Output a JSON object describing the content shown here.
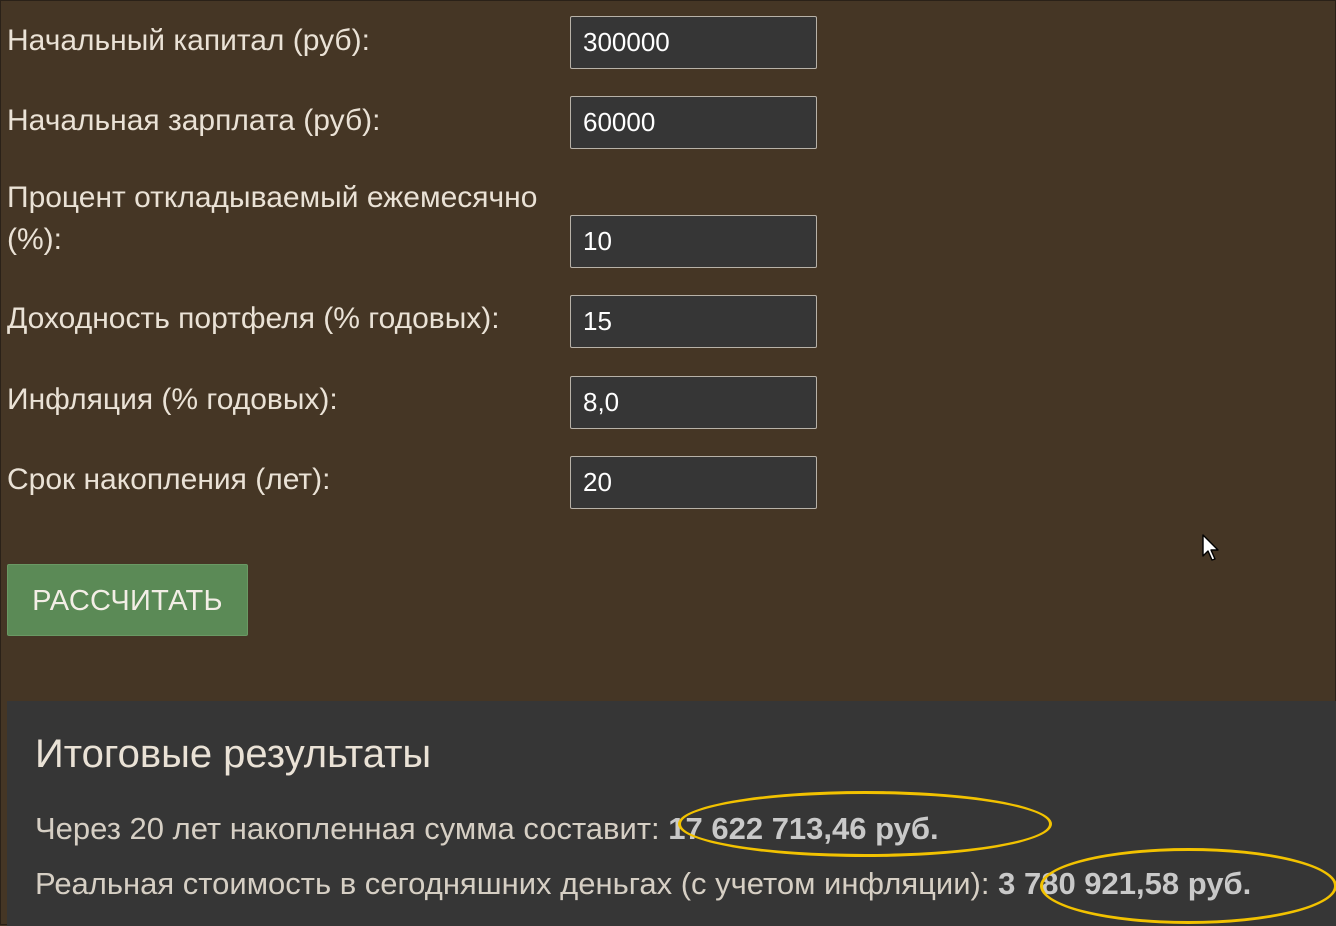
{
  "form": {
    "fields": [
      {
        "label": "Начальный капитал (руб):",
        "value": "300000"
      },
      {
        "label": "Начальная зарплата (руб):",
        "value": "60000"
      },
      {
        "label": "Процент откладываемый ежемесячно (%):",
        "value": "10"
      },
      {
        "label": "Доходность портфеля (% годовых):",
        "value": "15"
      },
      {
        "label": "Инфляция (% годовых):",
        "value": "8,0"
      },
      {
        "label": "Срок накопления (лет):",
        "value": "20"
      }
    ],
    "submit_label": "РАССЧИТАТЬ"
  },
  "results": {
    "title": "Итоговые результаты",
    "total_prefix": "Через 20 лет накопленная сумма составит: ",
    "total_value": "17 622 713,46 руб.",
    "real_prefix": "Реальная стоимость в сегодняшних деньгах (с учетом инфляции): ",
    "real_value": "3 780 921,58 руб."
  },
  "colors": {
    "page_background": "#453625",
    "results_background": "#363636",
    "button": "#5b8a56",
    "highlight": "#f2c200"
  },
  "icons": {
    "cursor": "mouse-pointer-icon"
  }
}
